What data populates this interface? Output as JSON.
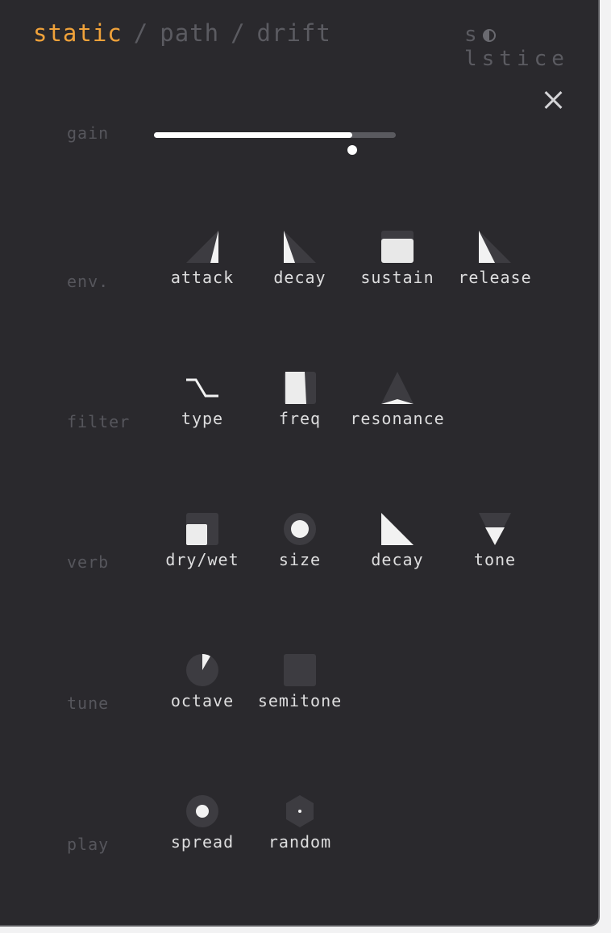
{
  "nav": {
    "tabs": [
      "static",
      "path",
      "drift"
    ],
    "separator": "/"
  },
  "brand": {
    "left": "s",
    "right": "lstice"
  },
  "icons": {
    "close": "close-icon"
  },
  "colors": {
    "accent": "#f0a23a",
    "background": "#2a292d",
    "muted": "#56565c",
    "control": "#3d3c41"
  },
  "gain": {
    "label": "gain",
    "value": 0.82
  },
  "rows": [
    {
      "label": "env.",
      "controls": [
        "attack",
        "decay",
        "sustain",
        "release"
      ]
    },
    {
      "label": "filter",
      "controls": [
        "type",
        "freq",
        "resonance"
      ]
    },
    {
      "label": "verb",
      "controls": [
        "dry/wet",
        "size",
        "decay",
        "tone"
      ]
    },
    {
      "label": "tune",
      "controls": [
        "octave",
        "semitone"
      ]
    },
    {
      "label": "play",
      "controls": [
        "spread",
        "random"
      ]
    }
  ]
}
